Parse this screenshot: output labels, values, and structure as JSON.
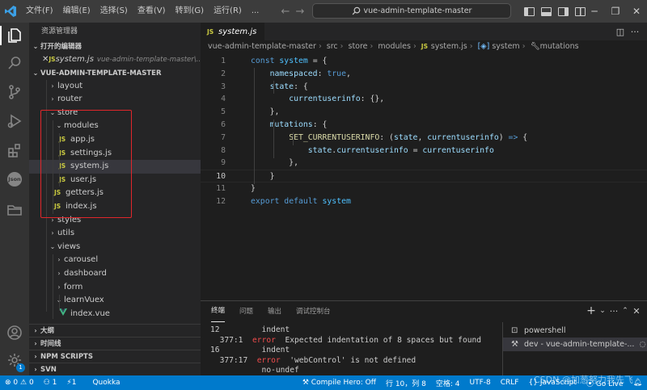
{
  "titlebar": {
    "menus": [
      "文件(F)",
      "编辑(E)",
      "选择(S)",
      "查看(V)",
      "转到(G)",
      "运行(R)",
      "..."
    ],
    "search": "vue-admin-template-master"
  },
  "activitybar": {
    "icons": [
      "explorer-icon",
      "search-icon",
      "source-control-icon",
      "run-debug-icon",
      "extensions-icon",
      "json-icon",
      "folder-icon",
      "account-icon",
      "settings-icon"
    ],
    "json_label": "Json",
    "badge": "1"
  },
  "sidebar": {
    "title": "资源管理器",
    "open_editors_label": "打开的编辑器",
    "open_editor": {
      "name": "system.js",
      "path": "vue-admin-template-master\\..."
    },
    "project_label": "VUE-ADMIN-TEMPLATE-MASTER",
    "tree": [
      {
        "label": "layout",
        "type": "folder"
      },
      {
        "label": "router",
        "type": "folder"
      },
      {
        "label": "store",
        "type": "folder-open"
      },
      {
        "label": "modules",
        "type": "folder-open"
      },
      {
        "label": "app.js",
        "type": "js"
      },
      {
        "label": "settings.js",
        "type": "js"
      },
      {
        "label": "system.js",
        "type": "js"
      },
      {
        "label": "user.js",
        "type": "js"
      },
      {
        "label": "getters.js",
        "type": "js"
      },
      {
        "label": "index.js",
        "type": "js"
      },
      {
        "label": "styles",
        "type": "folder"
      },
      {
        "label": "utils",
        "type": "folder"
      },
      {
        "label": "views",
        "type": "folder-open"
      },
      {
        "label": "carousel",
        "type": "folder"
      },
      {
        "label": "dashboard",
        "type": "folder"
      },
      {
        "label": "form",
        "type": "folder"
      },
      {
        "label": "learnVuex",
        "type": "folder-open"
      },
      {
        "label": "index.vue",
        "type": "vue"
      }
    ],
    "bottom_sections": [
      "大纲",
      "时间线",
      "NPM SCRIPTS",
      "SVN"
    ]
  },
  "editor": {
    "tab": "system.js",
    "breadcrumb": [
      "vue-admin-template-master",
      "src",
      "store",
      "modules",
      "system.js",
      "system",
      "mutations"
    ],
    "lines": [
      {
        "n": "1",
        "t": "const system = {"
      },
      {
        "n": "2",
        "t": "namespaced: true,"
      },
      {
        "n": "3",
        "t": "state: {"
      },
      {
        "n": "4",
        "t": "currentuserinfo: {},"
      },
      {
        "n": "5",
        "t": "},"
      },
      {
        "n": "6",
        "t": "mutations: {"
      },
      {
        "n": "7",
        "t": "SET_CURRENTUSERINFO: (state, currentuserinfo) => {"
      },
      {
        "n": "8",
        "t": "state.currentuserinfo = currentuserinfo"
      },
      {
        "n": "9",
        "t": "},"
      },
      {
        "n": "10",
        "t": "}"
      },
      {
        "n": "11",
        "t": "}"
      },
      {
        "n": "12",
        "t": "export default system"
      }
    ]
  },
  "panel": {
    "tabs": [
      "终端",
      "问题",
      "输出",
      "调试控制台"
    ],
    "terminal_lines": [
      {
        "a": "12",
        "b": "",
        "c": "",
        "d": "indent"
      },
      {
        "a": "",
        "b": "377:1",
        "c": "error",
        "d": "Expected indentation of 8 spaces but found"
      },
      {
        "a": "16",
        "b": "",
        "c": "",
        "d": "indent"
      },
      {
        "a": "",
        "b": "377:17",
        "c": "error",
        "d": "'webControl' is not defined"
      },
      {
        "a": "",
        "b": "",
        "c": "",
        "d": "no-undef"
      }
    ],
    "terminals": [
      "powershell",
      "dev - vue-admin-template-..."
    ]
  },
  "statusbar": {
    "errors": "0",
    "warnings": "0",
    "cursor_count": "1",
    "sync": "1",
    "quokka": "Quokka",
    "compile_hero": "Compile Hero: Off",
    "position": "行 10，列 8",
    "spaces": "空格: 4",
    "encoding": "UTF-8",
    "eol": "CRLF",
    "language": "JavaScript",
    "golive": "Go Live"
  },
  "watermark": "CSDN @加葱努力我先飞",
  "colors": {
    "accent": "#007acc",
    "highlight_box": "#e0262b",
    "js_icon": "#cbcb41"
  }
}
